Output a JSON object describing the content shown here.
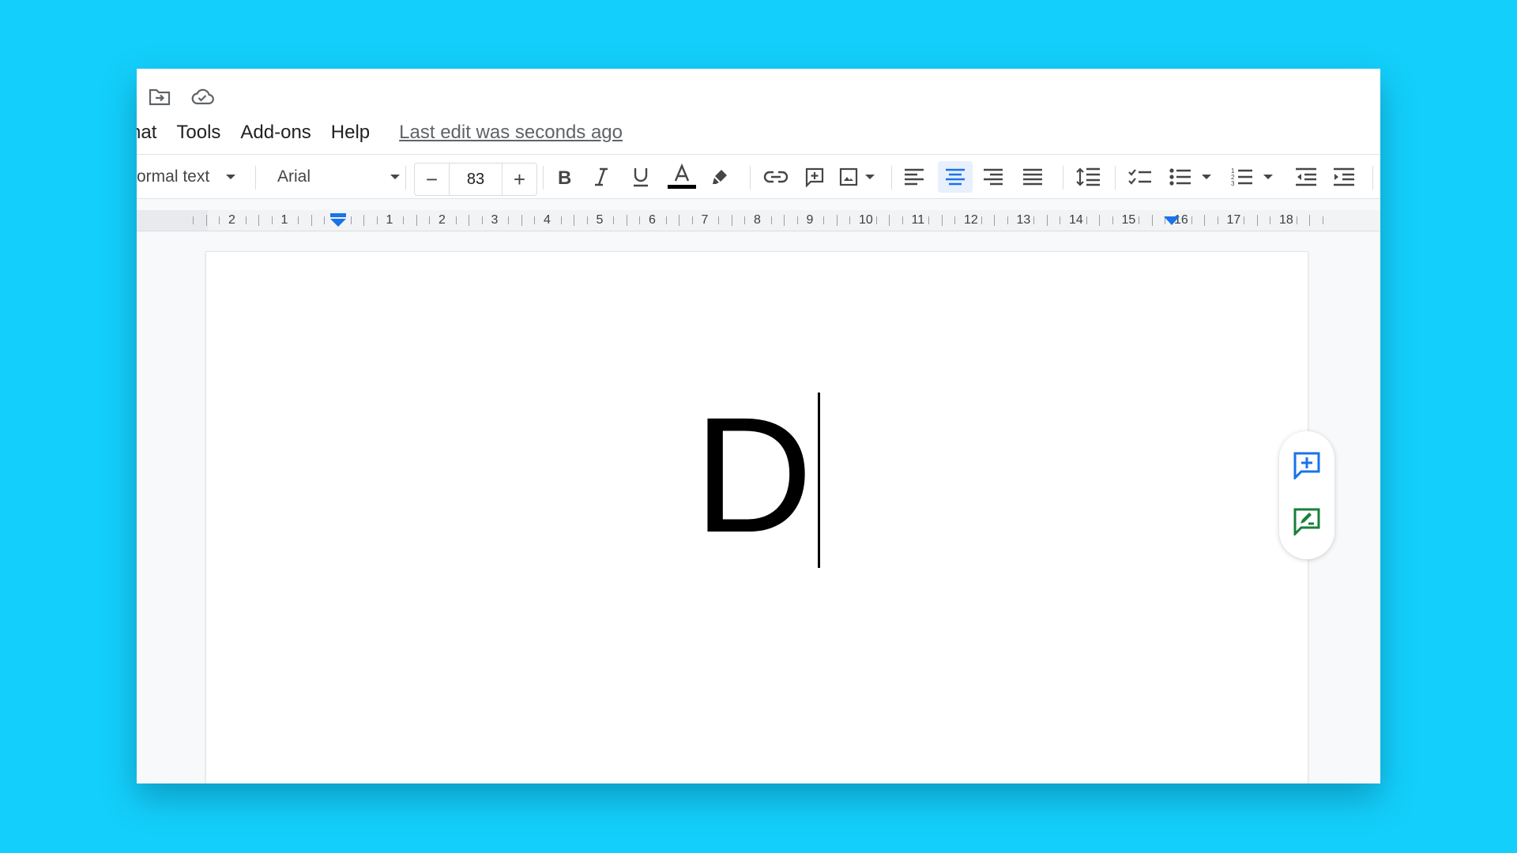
{
  "header": {
    "icons": [
      "move-to-folder-icon",
      "cloud-saved-icon"
    ]
  },
  "menubar": {
    "items": [
      "nat",
      "Tools",
      "Add-ons",
      "Help"
    ],
    "last_edit": "Last edit was seconds ago"
  },
  "toolbar": {
    "style_value": "ormal text",
    "font_value": "Arial",
    "font_size": "83",
    "decrease_label": "−",
    "increase_label": "+",
    "text_color": "#000000"
  },
  "ruler": {
    "labels": [
      "2",
      "1",
      "1",
      "2",
      "3",
      "4",
      "5",
      "6",
      "7",
      "8",
      "9",
      "10",
      "11",
      "12",
      "13",
      "14",
      "15",
      "16",
      "17",
      "18"
    ]
  },
  "document": {
    "text": "D"
  },
  "colors": {
    "background": "#13CFFB",
    "accent_blue": "#1A73E8",
    "accent_green": "#188038"
  }
}
